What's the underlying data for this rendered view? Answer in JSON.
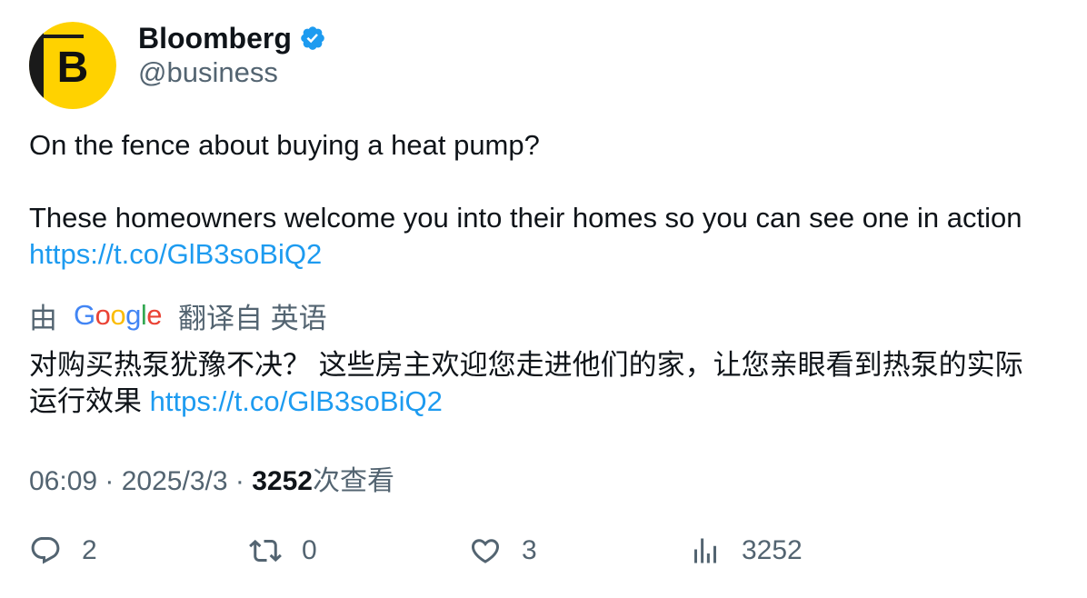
{
  "author": {
    "name": "Bloomberg",
    "handle": "@business",
    "avatar_letter": "B",
    "verified_icon": "verified-badge-icon"
  },
  "tweet": {
    "line1": "On the fence about buying a heat pump?",
    "line2": "These homeowners welcome you into their homes so you can see one in action",
    "link": "https://t.co/GlB3soBiQ2"
  },
  "translation": {
    "prefix": "由",
    "provider": "Google",
    "suffix": "翻译自 英语",
    "line1": "对购买热泵犹豫不决？ 这些房主欢迎您走进他们的家，让您亲眼看到热泵的实际",
    "line2_text": "运行效果",
    "link": "https://t.co/GlB3soBiQ2"
  },
  "meta": {
    "time": "06:09",
    "separator": " · ",
    "date": "2025/3/3",
    "views_count": "3252",
    "views_label": "次查看"
  },
  "actions": {
    "replies": "2",
    "retweets": "0",
    "likes": "3",
    "views": "3252"
  },
  "colors": {
    "link": "#1d9bf0",
    "muted": "#536471",
    "avatar_yellow": "#ffd200",
    "verified": "#1d9bf0"
  }
}
